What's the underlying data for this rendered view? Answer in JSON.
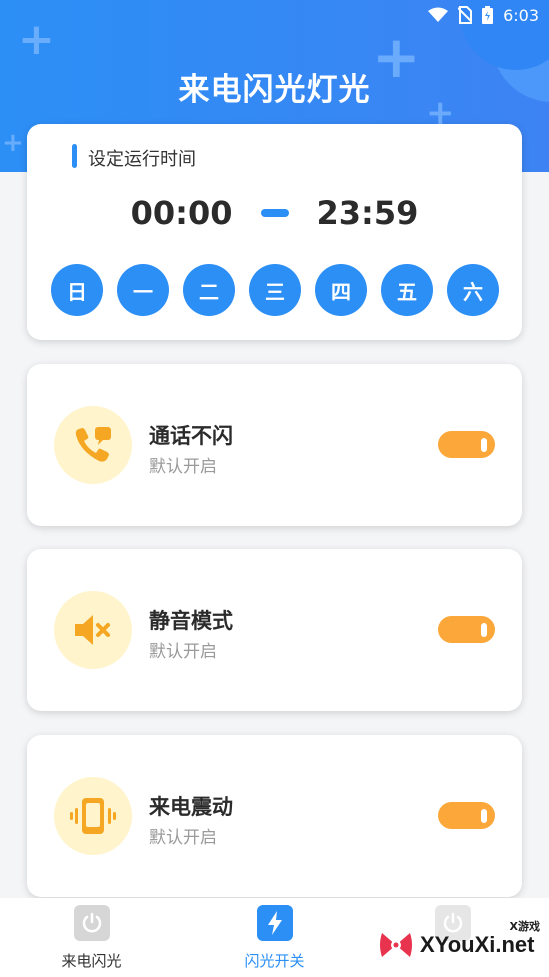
{
  "status_bar": {
    "time": "6:03"
  },
  "app": {
    "title": "来电闪光灯光"
  },
  "schedule": {
    "section_title": "设定运行时间",
    "start_time": "00:00",
    "end_time": "23:59",
    "days": [
      "日",
      "一",
      "二",
      "三",
      "四",
      "五",
      "六"
    ]
  },
  "options": [
    {
      "title": "通话不闪",
      "subtitle": "默认开启",
      "enabled": true,
      "icon": "phone-message-icon"
    },
    {
      "title": "静音模式",
      "subtitle": "默认开启",
      "enabled": true,
      "icon": "speaker-mute-icon"
    },
    {
      "title": "来电震动",
      "subtitle": "默认开启",
      "enabled": true,
      "icon": "phone-vibrate-icon"
    }
  ],
  "bottom_nav": [
    {
      "label": "来电闪光",
      "active": false
    },
    {
      "label": "闪光开关",
      "active": true
    },
    {
      "label": "",
      "active": false
    }
  ],
  "watermark": {
    "text": "XYouXi.net",
    "small": "X游戏"
  },
  "colors": {
    "primary": "#2c8ff6",
    "toggle_on": "#fba73a",
    "icon_bg": "#fff4cc",
    "icon_fg": "#f5a623"
  }
}
